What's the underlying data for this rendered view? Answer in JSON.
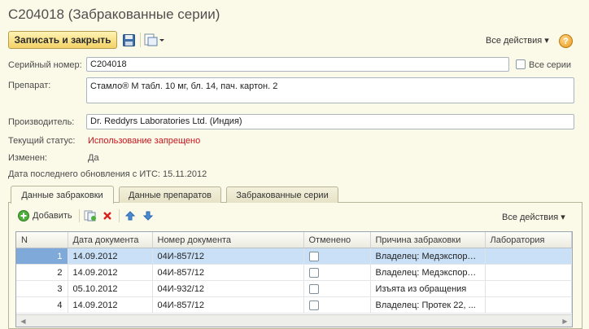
{
  "window": {
    "title": "С204018 (Забракованные серии)"
  },
  "toolbar": {
    "save_close": "Записать и закрыть",
    "all_actions": "Все действия",
    "help": "?"
  },
  "form": {
    "serial_label": "Серийный номер:",
    "serial_value": "С204018",
    "all_series_label": "Все серии",
    "drug_label": "Препарат:",
    "drug_value": "Стамло® М табл. 10 мг, бл. 14, пач. картон. 2",
    "manufacturer_label": "Производитель:",
    "manufacturer_value": "Dr. Reddyrs Laboratories Ltd. (Индия)",
    "status_label": "Текущий статус:",
    "status_value": "Использование запрещено",
    "changed_label": "Изменен:",
    "changed_value": "Да",
    "last_update": "Дата последнего обновления с ИТС: 15.11.2012"
  },
  "tabs": [
    {
      "label": "Данные забраковки"
    },
    {
      "label": "Данные препаратов"
    },
    {
      "label": "Забракованные серии"
    }
  ],
  "table_toolbar": {
    "add_label": "Добавить",
    "all_actions": "Все действия"
  },
  "table": {
    "columns": [
      "N",
      "Дата документа",
      "Номер документа",
      "Отменено",
      "Причина забраковки",
      "Лаборатория"
    ],
    "rows": [
      {
        "n": "1",
        "date": "14.09.2012",
        "doc": "04И-857/12",
        "reason": "Владелец: Медэкспорт-...",
        "lab": ""
      },
      {
        "n": "2",
        "date": "14.09.2012",
        "doc": "04И-857/12",
        "reason": "Владелец: Медэкспорт ...",
        "lab": ""
      },
      {
        "n": "3",
        "date": "05.10.2012",
        "doc": "04И-932/12",
        "reason": "Изъята из обращения",
        "lab": ""
      },
      {
        "n": "4",
        "date": "14.09.2012",
        "doc": "04И-857/12",
        "reason": "Владелец: Протек 22, ...",
        "lab": ""
      }
    ]
  }
}
